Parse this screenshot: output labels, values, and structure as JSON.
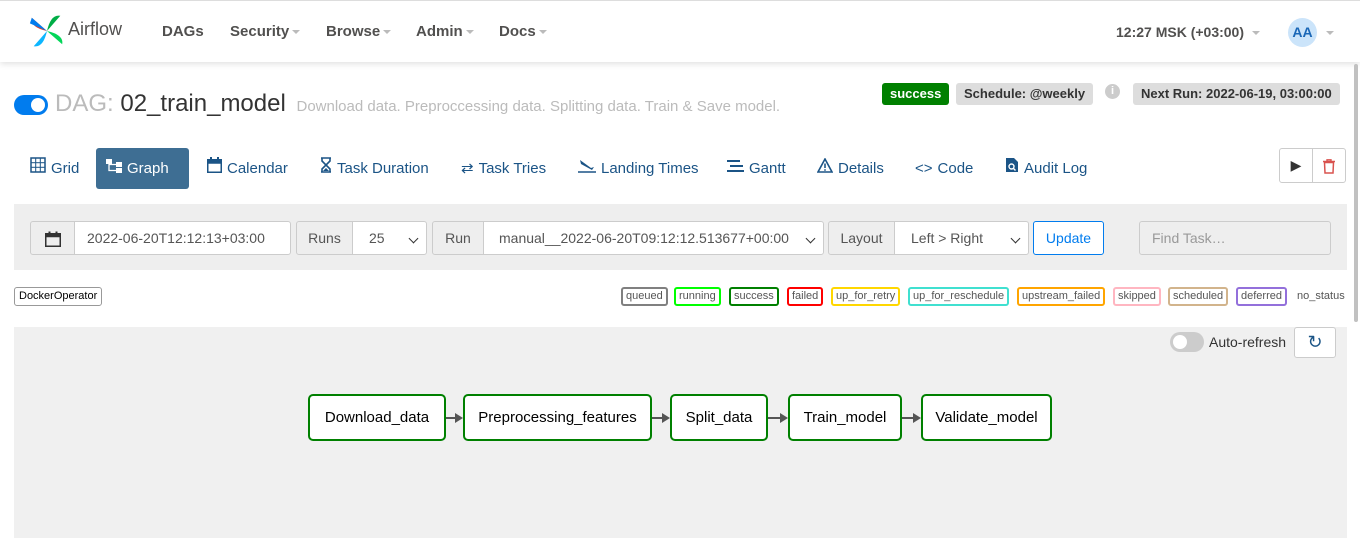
{
  "navbar": {
    "brand": "Airflow",
    "items": [
      {
        "label": "DAGs",
        "dropdown": false
      },
      {
        "label": "Security",
        "dropdown": true
      },
      {
        "label": "Browse",
        "dropdown": true
      },
      {
        "label": "Admin",
        "dropdown": true
      },
      {
        "label": "Docs",
        "dropdown": true
      }
    ],
    "clock": "12:27 MSK (+03:00)",
    "avatar_initials": "AA"
  },
  "header": {
    "dag_prefix": "DAG:",
    "dag_id": "02_train_model",
    "description": "Download data. Preproccessing data. Splitting data. Train & Save model.",
    "status_badge": "success",
    "schedule": "Schedule: @weekly",
    "info_icon": "i",
    "next_run": "Next Run: 2022-06-19, 03:00:00"
  },
  "tabs": [
    {
      "label": "Grid",
      "icon": "grid-icon",
      "active": false
    },
    {
      "label": "Graph",
      "icon": "graph-icon",
      "active": true
    },
    {
      "label": "Calendar",
      "icon": "calendar-icon",
      "active": false
    },
    {
      "label": "Task Duration",
      "icon": "hourglass-icon",
      "active": false
    },
    {
      "label": "Task Tries",
      "icon": "retry-icon",
      "active": false
    },
    {
      "label": "Landing Times",
      "icon": "landing-icon",
      "active": false
    },
    {
      "label": "Gantt",
      "icon": "gantt-icon",
      "active": false
    },
    {
      "label": "Details",
      "icon": "warning-triangle-icon",
      "active": false
    },
    {
      "label": "Code",
      "icon": "code-icon",
      "active": false
    },
    {
      "label": "Audit Log",
      "icon": "audit-log-icon",
      "active": false
    }
  ],
  "form": {
    "base_date": "2022-06-20T12:12:13+03:00",
    "runs_label": "Runs",
    "runs_value": "25",
    "run_label": "Run",
    "run_value": "manual__2022-06-20T09:12:12.513677+00:00",
    "layout_label": "Layout",
    "layout_value": "Left > Right",
    "update_label": "Update",
    "find_task_placeholder": "Find Task…"
  },
  "legend": {
    "operator": "DockerOperator",
    "states": [
      {
        "label": "queued",
        "color": "#808080"
      },
      {
        "label": "running",
        "color": "#00ff00"
      },
      {
        "label": "success",
        "color": "#008000"
      },
      {
        "label": "failed",
        "color": "#ff0000"
      },
      {
        "label": "up_for_retry",
        "color": "#ffd700"
      },
      {
        "label": "up_for_reschedule",
        "color": "#40e0d0"
      },
      {
        "label": "upstream_failed",
        "color": "#ffa500"
      },
      {
        "label": "skipped",
        "color": "#ffb6c1"
      },
      {
        "label": "scheduled",
        "color": "#d2b48c"
      },
      {
        "label": "deferred",
        "color": "#9370db"
      },
      {
        "label": "no_status",
        "color": null
      }
    ]
  },
  "graph": {
    "auto_refresh_label": "Auto-refresh",
    "nodes": [
      {
        "label": "Download_data",
        "state": "success"
      },
      {
        "label": "Preprocessing_features",
        "state": "success"
      },
      {
        "label": "Split_data",
        "state": "success"
      },
      {
        "label": "Train_model",
        "state": "success"
      },
      {
        "label": "Validate_model",
        "state": "success"
      }
    ]
  },
  "colors": {
    "primary": "#017cee",
    "active_tab": "#3e6e93",
    "success": "#008000",
    "link": "#1b5486"
  }
}
